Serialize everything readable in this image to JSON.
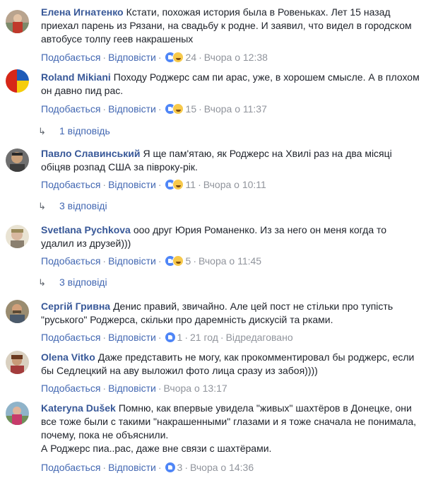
{
  "comments": [
    {
      "author": "Елена Игнатенко",
      "text": "Кстати, похожая история была в Ровеньках. Лет 15 назад приехал парень из Рязани, на свадьбу к родне. И заявил, что видел в городском автобусе толпу геев накрашеных",
      "like_label": "Подобається",
      "reply_label": "Відповісти",
      "reaction_count": "24",
      "time": "Вчора о 12:38",
      "reactions": [
        "like",
        "haha"
      ]
    },
    {
      "author": "Roland Mikiani",
      "text": "Походу Роджерс сам пи  арас, уже, в хорошем смысле. А в плохом он давно пид  рас.",
      "like_label": "Подобається",
      "reply_label": "Відповісти",
      "reaction_count": "15",
      "time": "Вчора о 11:37",
      "reactions": [
        "like",
        "haha"
      ],
      "replies": "1 відповідь"
    },
    {
      "author": "Павло Славинський",
      "text": "Я ще пам'ятаю, як Роджерс на Хвилі раз на два місяці обіцяв розпад США за півроку-рік.",
      "like_label": "Подобається",
      "reply_label": "Відповісти",
      "reaction_count": "11",
      "time": "Вчора о 10:11",
      "reactions": [
        "like",
        "haha"
      ],
      "replies": "3 відповіді"
    },
    {
      "author": "Svetlana Pychkova",
      "text": "ооо друг Юрия Романенко. Из за него он меня когда то удалил из друзей)))",
      "like_label": "Подобається",
      "reply_label": "Відповісти",
      "reaction_count": "5",
      "time": "Вчора о 11:45",
      "reactions": [
        "like",
        "haha"
      ],
      "replies": "3 відповіді"
    },
    {
      "author": "Сергій Гривна",
      "text": "Денис правий, звичайно. Але цей пост не стільки про тупість \"руського\" Роджерса, скільки про даремність дискусій та рками.",
      "like_label": "Подобається",
      "reply_label": "Відповісти",
      "reaction_count": "1",
      "time": "21 год",
      "edited": "Відредаговано",
      "reactions": [
        "like"
      ]
    },
    {
      "author": "Olena Vitko",
      "text": "Даже представить не могу, как прокомментировал бы роджерс, если бы Седлецкий на аву выложил фото лица сразу из забоя))))",
      "like_label": "Подобається",
      "reply_label": "Відповісти",
      "time": "Вчора о 13:17",
      "reactions": []
    },
    {
      "author": "Kateryna Dušek",
      "text": "Помню, как впервые увидела \"живых\" шахтёров в Донецке, они все тоже были с такими \"накрашенными\" глазами и я тоже сначала не понимала, почему, пока не объяснили.",
      "text2": "А Роджерс пиа..рас, даже вне связи с шахтёрами.",
      "like_label": "Подобається",
      "reply_label": "Відповісти",
      "reaction_count": "3",
      "time": "Вчора о 14:36",
      "reactions": [
        "like"
      ]
    }
  ],
  "colors": {
    "author": "#385898",
    "link": "#4267b2",
    "meta": "#90949c",
    "text": "#1d2129"
  }
}
